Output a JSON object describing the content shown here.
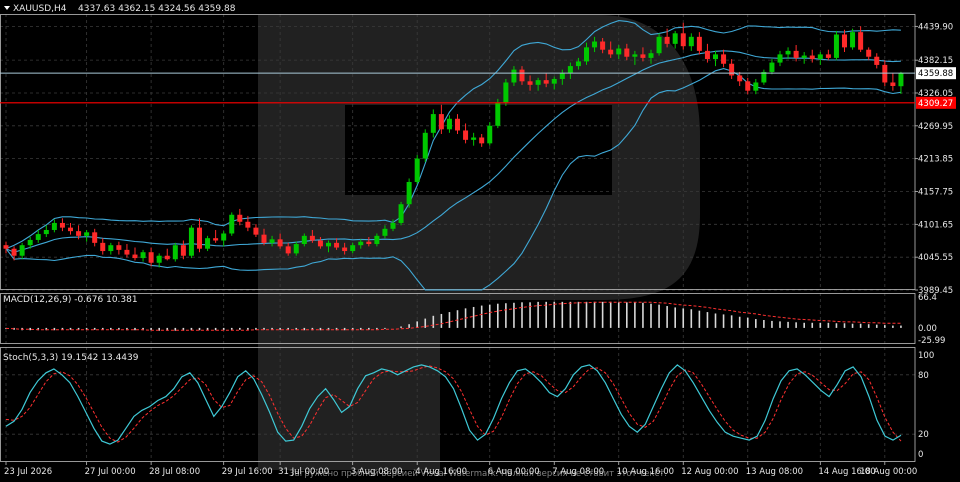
{
  "header": {
    "symbol": "XAUUSD,H4",
    "ohlc": "4337.63 4362.15 4324.56 4359.88"
  },
  "indicators": {
    "macd_label": "MACD(12,26,9) -0.676 10.381",
    "stoch_label": "Stoch(5,3,3) 19.1542 13.4439"
  },
  "watermark_text": "Загружено пробной версией Visual Watermark. Полная версия не ставит этот текст.",
  "colors": {
    "background": "#000000",
    "grid": "#3a3a3a",
    "bull": "#00c800",
    "bear": "#ff2a2a",
    "bollinger": "#3fa8d6",
    "price_line": "#a9c9d8",
    "level_line": "#ff0000",
    "macd_hist": "#d9d9d9",
    "macd_signal": "#ff3030",
    "stoch_main": "#3fc9d6",
    "stoch_signal": "#ff3030"
  },
  "chart_data": [
    {
      "type": "candlestick",
      "title": "XAUUSD,H4",
      "ylim": [
        3989.45,
        4461
      ],
      "y_ticks": [
        "4439.90",
        "4382.15",
        "4326.05",
        "4269.95",
        "4213.85",
        "4157.75",
        "4101.65",
        "4045.55",
        "3989.45"
      ],
      "y_tick_values": [
        4439.9,
        4382.15,
        4326.05,
        4269.95,
        4213.85,
        4157.75,
        4101.65,
        4045.55,
        3989.45
      ],
      "current_price": 4359.88,
      "current_price_label": "4359.88",
      "level_price": 4309.27,
      "level_label": "4309.27",
      "x_ticks": [
        "23 Jul 2026",
        "27 Jul 00:00",
        "28 Jul 08:00",
        "29 Jul 16:00",
        "31 Jul 00:00",
        "3 Aug 08:00",
        "4 Aug 16:00",
        "6 Aug 00:00",
        "7 Aug 08:00",
        "10 Aug 16:00",
        "12 Aug 00:00",
        "13 Aug 08:00",
        "14 Aug 16:00",
        "18 Aug 00:00"
      ],
      "x_tick_indices": [
        0,
        10,
        18,
        27,
        34,
        43,
        51,
        60,
        68,
        76,
        84,
        92,
        101,
        109
      ],
      "candles": [
        [
          4066,
          4072,
          4052,
          4060
        ],
        [
          4060,
          4064,
          4040,
          4048
        ],
        [
          4048,
          4070,
          4042,
          4066
        ],
        [
          4066,
          4080,
          4060,
          4075
        ],
        [
          4075,
          4092,
          4070,
          4085
        ],
        [
          4085,
          4100,
          4080,
          4092
        ],
        [
          4092,
          4110,
          4088,
          4104
        ],
        [
          4104,
          4112,
          4090,
          4096
        ],
        [
          4096,
          4104,
          4084,
          4090
        ],
        [
          4090,
          4100,
          4076,
          4082
        ],
        [
          4082,
          4092,
          4072,
          4088
        ],
        [
          4088,
          4094,
          4064,
          4070
        ],
        [
          4070,
          4078,
          4050,
          4056
        ],
        [
          4056,
          4070,
          4050,
          4066
        ],
        [
          4066,
          4072,
          4050,
          4058
        ],
        [
          4058,
          4068,
          4045,
          4050
        ],
        [
          4050,
          4062,
          4040,
          4044
        ],
        [
          4044,
          4058,
          4038,
          4054
        ],
        [
          4054,
          4062,
          4030,
          4036
        ],
        [
          4036,
          4052,
          4028,
          4048
        ],
        [
          4048,
          4060,
          4040,
          4042
        ],
        [
          4042,
          4070,
          4038,
          4066
        ],
        [
          4066,
          4074,
          4042,
          4048
        ],
        [
          4048,
          4100,
          4044,
          4096
        ],
        [
          4096,
          4112,
          4054,
          4060
        ],
        [
          4060,
          4082,
          4056,
          4078
        ],
        [
          4078,
          4092,
          4070,
          4074
        ],
        [
          4074,
          4090,
          4064,
          4086
        ],
        [
          4086,
          4122,
          4082,
          4118
        ],
        [
          4118,
          4128,
          4100,
          4106
        ],
        [
          4106,
          4116,
          4090,
          4096
        ],
        [
          4096,
          4102,
          4080,
          4084
        ],
        [
          4084,
          4094,
          4066,
          4070
        ],
        [
          4070,
          4082,
          4064,
          4076
        ],
        [
          4076,
          4086,
          4060,
          4064
        ],
        [
          4064,
          4070,
          4048,
          4052
        ],
        [
          4052,
          4072,
          4048,
          4068
        ],
        [
          4068,
          4086,
          4064,
          4082
        ],
        [
          4082,
          4092,
          4070,
          4074
        ],
        [
          4074,
          4080,
          4060,
          4064
        ],
        [
          4064,
          4074,
          4054,
          4070
        ],
        [
          4070,
          4078,
          4058,
          4062
        ],
        [
          4062,
          4070,
          4050,
          4056
        ],
        [
          4056,
          4070,
          4052,
          4066
        ],
        [
          4066,
          4076,
          4060,
          4072
        ],
        [
          4072,
          4080,
          4064,
          4068
        ],
        [
          4068,
          4086,
          4064,
          4082
        ],
        [
          4082,
          4100,
          4078,
          4094
        ],
        [
          4094,
          4110,
          4090,
          4104
        ],
        [
          4104,
          4140,
          4100,
          4136
        ],
        [
          4136,
          4180,
          4130,
          4174
        ],
        [
          4174,
          4220,
          4170,
          4214
        ],
        [
          4214,
          4264,
          4208,
          4258
        ],
        [
          4258,
          4298,
          4250,
          4290
        ],
        [
          4290,
          4306,
          4256,
          4264
        ],
        [
          4264,
          4288,
          4258,
          4282
        ],
        [
          4282,
          4290,
          4256,
          4262
        ],
        [
          4262,
          4274,
          4240,
          4246
        ],
        [
          4246,
          4258,
          4236,
          4250
        ],
        [
          4250,
          4256,
          4234,
          4240
        ],
        [
          4240,
          4276,
          4236,
          4270
        ],
        [
          4270,
          4316,
          4266,
          4310
        ],
        [
          4310,
          4350,
          4304,
          4344
        ],
        [
          4344,
          4372,
          4338,
          4366
        ],
        [
          4366,
          4372,
          4340,
          4346
        ],
        [
          4346,
          4356,
          4330,
          4340
        ],
        [
          4340,
          4352,
          4330,
          4348
        ],
        [
          4348,
          4360,
          4336,
          4342
        ],
        [
          4342,
          4354,
          4332,
          4350
        ],
        [
          4350,
          4366,
          4340,
          4360
        ],
        [
          4360,
          4378,
          4350,
          4372
        ],
        [
          4372,
          4386,
          4366,
          4380
        ],
        [
          4380,
          4412,
          4374,
          4404
        ],
        [
          4404,
          4422,
          4396,
          4414
        ],
        [
          4414,
          4420,
          4394,
          4400
        ],
        [
          4400,
          4414,
          4386,
          4392
        ],
        [
          4392,
          4408,
          4384,
          4402
        ],
        [
          4402,
          4410,
          4382,
          4388
        ],
        [
          4388,
          4398,
          4374,
          4392
        ],
        [
          4392,
          4404,
          4380,
          4386
        ],
        [
          4386,
          4400,
          4376,
          4394
        ],
        [
          4394,
          4428,
          4390,
          4422
        ],
        [
          4422,
          4436,
          4404,
          4410
        ],
        [
          4410,
          4432,
          4402,
          4428
        ],
        [
          4428,
          4446,
          4400,
          4406
        ],
        [
          4406,
          4428,
          4398,
          4422
        ],
        [
          4422,
          4430,
          4392,
          4398
        ],
        [
          4398,
          4410,
          4378,
          4384
        ],
        [
          4384,
          4398,
          4372,
          4392
        ],
        [
          4392,
          4400,
          4370,
          4376
        ],
        [
          4376,
          4384,
          4350,
          4356
        ],
        [
          4356,
          4362,
          4338,
          4346
        ],
        [
          4346,
          4352,
          4324,
          4330
        ],
        [
          4330,
          4350,
          4324,
          4344
        ],
        [
          4344,
          4366,
          4340,
          4362
        ],
        [
          4362,
          4384,
          4358,
          4378
        ],
        [
          4378,
          4398,
          4372,
          4392
        ],
        [
          4392,
          4404,
          4384,
          4398
        ],
        [
          4398,
          4408,
          4380,
          4386
        ],
        [
          4386,
          4396,
          4376,
          4390
        ],
        [
          4390,
          4400,
          4378,
          4384
        ],
        [
          4384,
          4396,
          4374,
          4392
        ],
        [
          4392,
          4400,
          4382,
          4386
        ],
        [
          4386,
          4432,
          4382,
          4426
        ],
        [
          4426,
          4434,
          4396,
          4404
        ],
        [
          4404,
          4436,
          4400,
          4430
        ],
        [
          4430,
          4440,
          4396,
          4400
        ],
        [
          4400,
          4404,
          4382,
          4388
        ],
        [
          4388,
          4394,
          4368,
          4374
        ],
        [
          4374,
          4382,
          4338,
          4344
        ],
        [
          4344,
          4360,
          4330,
          4338
        ],
        [
          4337.63,
          4362.15,
          4324.56,
          4359.88
        ]
      ]
    },
    {
      "type": "bar",
      "title": "MACD(12,26,9) -0.676 10.381",
      "ylim": [
        -25.99,
        66.4
      ],
      "y_ticks": [
        "66.4",
        "0.00",
        "-25.99"
      ],
      "y_tick_values": [
        66.4,
        0,
        -25.99
      ],
      "histogram": [
        -2,
        -4,
        -5,
        -5,
        -5,
        -5,
        -5,
        -4,
        -4,
        -4,
        -4,
        -4,
        -4,
        -4,
        -4,
        -5,
        -5,
        -5,
        -5,
        -6,
        -6,
        -6,
        -6,
        -5,
        -5,
        -5,
        -5,
        -5,
        -4,
        -4,
        -4,
        -4,
        -4,
        -4,
        -4,
        -4,
        -4,
        -5,
        -5,
        -5,
        -5,
        -5,
        -5,
        -5,
        -4,
        -4,
        -3,
        -2,
        0,
        3,
        8,
        14,
        20,
        26,
        30,
        34,
        38,
        42,
        45,
        48,
        50,
        52,
        53,
        54,
        55,
        55,
        56,
        56,
        56,
        56,
        56,
        56,
        56,
        56,
        56,
        56,
        55,
        55,
        55,
        54,
        52,
        50,
        47,
        44,
        42,
        40,
        37,
        34,
        31,
        29,
        27,
        24,
        22,
        19,
        17,
        15,
        14,
        13,
        12,
        11,
        11,
        11,
        11,
        10,
        10,
        9,
        9,
        8,
        7,
        6,
        5,
        5
      ],
      "signal": [
        -1,
        -2,
        -3,
        -3,
        -4,
        -4,
        -4,
        -4,
        -4,
        -4,
        -4,
        -4,
        -4,
        -4,
        -4,
        -4,
        -4,
        -4,
        -5,
        -5,
        -5,
        -5,
        -5,
        -5,
        -5,
        -5,
        -5,
        -5,
        -5,
        -5,
        -5,
        -4,
        -4,
        -4,
        -4,
        -4,
        -4,
        -4,
        -4,
        -4,
        -4,
        -4,
        -4,
        -4,
        -4,
        -4,
        -4,
        -3,
        -3,
        -2,
        -1,
        1,
        3,
        6,
        9,
        13,
        17,
        21,
        25,
        29,
        33,
        36,
        39,
        41,
        44,
        46,
        48,
        49,
        51,
        52,
        53,
        54,
        54,
        55,
        55,
        55,
        55,
        55,
        55,
        55,
        55,
        54,
        53,
        51,
        49,
        48,
        46,
        44,
        41,
        39,
        37,
        34,
        32,
        30,
        27,
        25,
        23,
        21,
        19,
        18,
        17,
        16,
        15,
        14,
        13,
        13,
        12,
        11,
        11,
        10,
        10,
        10
      ]
    },
    {
      "type": "line",
      "title": "Stoch(5,3,3) 19.1542 13.4439",
      "ylim": [
        0,
        100
      ],
      "y_ticks": [
        "100",
        "80",
        "20",
        "0"
      ],
      "y_tick_values": [
        100,
        80,
        20,
        0
      ],
      "series": [
        {
          "values": [
            28,
            33,
            45,
            62,
            74,
            82,
            86,
            80,
            72,
            58,
            42,
            26,
            13,
            10,
            14,
            26,
            38,
            44,
            48,
            54,
            58,
            66,
            78,
            82,
            72,
            55,
            38,
            48,
            62,
            78,
            84,
            76,
            60,
            42,
            22,
            13,
            14,
            28,
            46,
            58,
            66,
            55,
            42,
            48,
            66,
            79,
            82,
            86,
            84,
            80,
            84,
            88,
            90,
            88,
            84,
            78,
            66,
            46,
            24,
            14,
            20,
            36,
            56,
            72,
            84,
            86,
            80,
            72,
            62,
            58,
            66,
            80,
            88,
            90,
            84,
            72,
            56,
            40,
            28,
            22,
            30,
            48,
            66,
            82,
            90,
            84,
            72,
            58,
            44,
            32,
            22,
            18,
            16,
            14,
            18,
            34,
            56,
            74,
            84,
            86,
            80,
            72,
            64,
            58,
            70,
            84,
            88,
            78,
            58,
            34,
            18,
            14,
            19
          ]
        },
        {
          "values": [
            35,
            34,
            38,
            47,
            60,
            73,
            81,
            83,
            79,
            70,
            57,
            42,
            27,
            16,
            12,
            17,
            26,
            36,
            43,
            49,
            53,
            59,
            67,
            75,
            77,
            70,
            55,
            47,
            49,
            63,
            75,
            79,
            73,
            59,
            41,
            26,
            16,
            18,
            29,
            44,
            57,
            60,
            54,
            48,
            52,
            64,
            76,
            82,
            84,
            83,
            83,
            84,
            87,
            89,
            87,
            83,
            76,
            63,
            45,
            28,
            19,
            23,
            37,
            55,
            71,
            81,
            83,
            79,
            71,
            64,
            62,
            68,
            78,
            86,
            87,
            82,
            71,
            56,
            41,
            30,
            27,
            33,
            48,
            65,
            79,
            85,
            82,
            71,
            58,
            45,
            33,
            24,
            19,
            16,
            16,
            22,
            36,
            55,
            71,
            81,
            83,
            79,
            72,
            65,
            64,
            71,
            81,
            83,
            75,
            57,
            37,
            22,
            13
          ]
        }
      ]
    }
  ]
}
